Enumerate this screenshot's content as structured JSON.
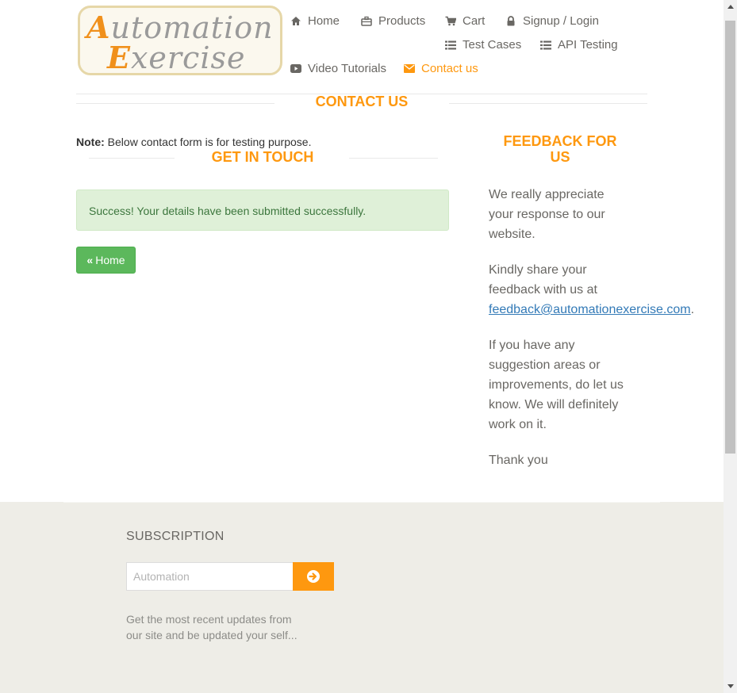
{
  "logo": {
    "line1_cap": "A",
    "line1_rest": "utomation",
    "line2_cap": "E",
    "line2_rest": "xercise"
  },
  "nav": {
    "items": [
      {
        "label": "Home",
        "icon": "home-icon"
      },
      {
        "label": "Products",
        "icon": "briefcase-icon"
      },
      {
        "label": "Cart",
        "icon": "cart-icon"
      },
      {
        "label": "Signup / Login",
        "icon": "lock-icon"
      },
      {
        "label": "Test Cases",
        "icon": "list-icon"
      },
      {
        "label": "API Testing",
        "icon": "list-icon"
      },
      {
        "label": "Video Tutorials",
        "icon": "youtube-play-icon"
      },
      {
        "label": "Contact us",
        "icon": "envelope-icon",
        "active": true
      }
    ]
  },
  "contact": {
    "title": "CONTACT US",
    "note_label": "Note:",
    "note_text": " Below contact form is for testing purpose.",
    "get_in_touch": "GET IN TOUCH",
    "success_message": "Success! Your details have been submitted successfully.",
    "home_button": "Home"
  },
  "feedback": {
    "title_line1": "FEEDBACK FOR",
    "title_line2": "US",
    "p1": "We really appreciate your response to our website.",
    "p2_text": "Kindly share your feedback with us at ",
    "p2_email": "feedback@automationexercise.com",
    "p2_end": ".",
    "p3": "If you have any suggestion areas or improvements, do let us know. We will definitely work on it.",
    "p4": "Thank you"
  },
  "footer": {
    "subscription_title": "SUBSCRIPTION",
    "email_placeholder": "Automation",
    "email_value": "",
    "description": "Get the most recent updates from our site and be updated your self..."
  },
  "colors": {
    "accent": "#fe980f",
    "success_bg": "#dff0d8",
    "success_text": "#3c763d",
    "button_green": "#5cb85c",
    "footer_bg": "#eeede7"
  }
}
